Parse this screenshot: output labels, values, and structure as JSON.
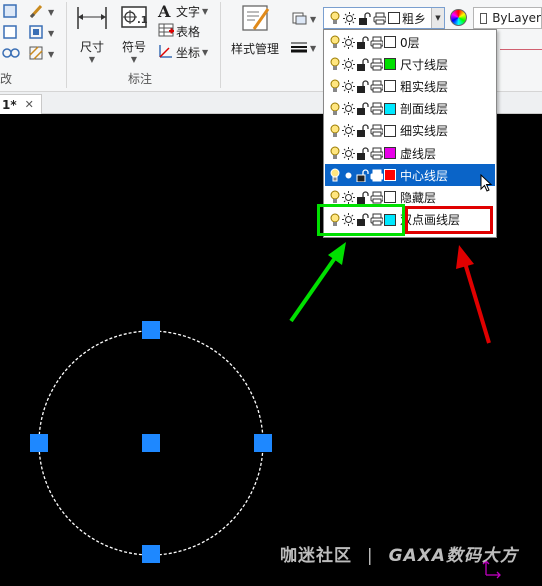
{
  "ribbon": {
    "dimension_label": "尺寸",
    "symbol_label": "符号",
    "text_label": "文字",
    "table_label": "表格",
    "coord_label": "坐标",
    "annotate_group_label": "标注",
    "left_group_label": "改",
    "style_manager_label": "样式管理",
    "current_layer_text": "粗乡",
    "color_value": "ByLayer"
  },
  "layer_dropdown": {
    "layers": [
      {
        "name": "0层",
        "color": "#ffffff"
      },
      {
        "name": "尺寸线层",
        "color": "#00e000"
      },
      {
        "name": "粗实线层",
        "color": "#ffffff"
      },
      {
        "name": "剖面线层",
        "color": "#00e8ff"
      },
      {
        "name": "细实线层",
        "color": "#ffffff"
      },
      {
        "name": "虚线层",
        "color": "#e800e8"
      },
      {
        "name": "中心线层",
        "color": "#ff0000"
      },
      {
        "name": "隐藏层",
        "color": "#ffffff"
      },
      {
        "name": "双点画线层",
        "color": "#00e8ff"
      }
    ],
    "selected_layer": "中心线层"
  },
  "tabs": [
    {
      "label": "1*"
    }
  ],
  "watermark": {
    "left": "咖迷社区",
    "separator": "|",
    "brand": "GAXA数码大方"
  },
  "colors": {
    "grip": "#1e88ff",
    "annotation_green": "#00e000",
    "annotation_red": "#e00000",
    "selected_row": "#0a64c8"
  }
}
